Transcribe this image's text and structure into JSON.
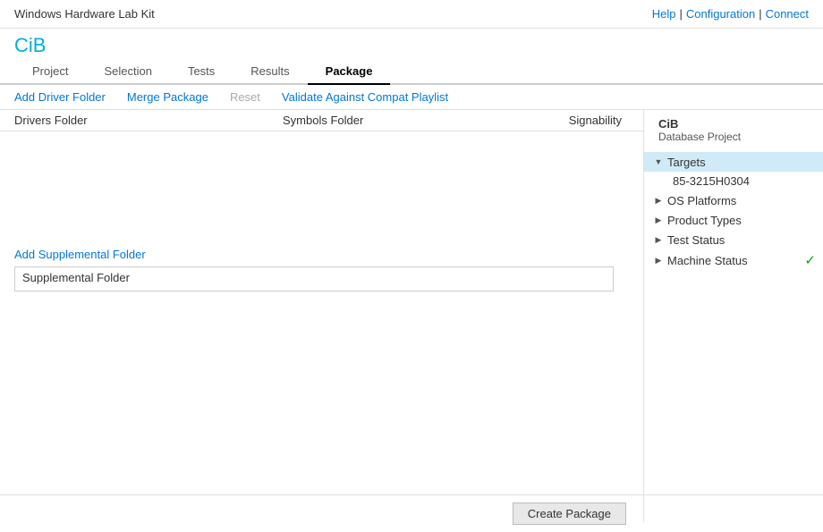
{
  "app": {
    "title": "Windows Hardware Lab Kit",
    "short_title": "CiB"
  },
  "header": {
    "links": [
      "Help",
      "|",
      "Configuration",
      "|",
      "Connect"
    ]
  },
  "nav": {
    "tabs": [
      {
        "label": "Project",
        "active": false
      },
      {
        "label": "Selection",
        "active": false
      },
      {
        "label": "Tests",
        "active": false
      },
      {
        "label": "Results",
        "active": false
      },
      {
        "label": "Package",
        "active": true
      }
    ]
  },
  "toolbar": {
    "add_driver_folder": "Add Driver Folder",
    "merge_package": "Merge Package",
    "reset": "Reset",
    "validate": "Validate Against Compat Playlist"
  },
  "columns": {
    "drivers_folder": "Drivers Folder",
    "symbols_folder": "Symbols Folder",
    "signability": "Signability"
  },
  "supplemental": {
    "link_label": "Add Supplemental Folder",
    "folder_label": "Supplemental Folder"
  },
  "right_panel": {
    "project_name": "CiB",
    "project_type": "Database Project",
    "tree": {
      "targets_label": "Targets",
      "target_id": "85-3215H0304",
      "items": [
        {
          "label": "OS Platforms",
          "expanded": false,
          "has_check": false
        },
        {
          "label": "Product Types",
          "expanded": false,
          "has_check": false
        },
        {
          "label": "Test Status",
          "expanded": false,
          "has_check": false
        },
        {
          "label": "Machine Status",
          "expanded": false,
          "has_check": true
        }
      ]
    }
  },
  "bottom": {
    "create_package_label": "Create Package"
  }
}
